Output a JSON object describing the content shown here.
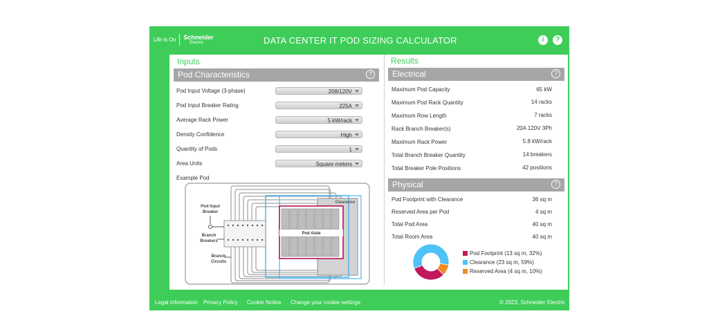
{
  "header": {
    "logo_tagline": "Life Is On",
    "brand_name": "Schneider",
    "brand_sub": "Electric",
    "title": "DATA CENTER IT POD SIZING CALCULATOR",
    "info_icon": "i",
    "help_icon": "?"
  },
  "inputs": {
    "title": "Inputs",
    "section_label": "Pod Characteristics",
    "fields": [
      {
        "label": "Pod Input Voltage (3-phase)",
        "value": "208/120V"
      },
      {
        "label": "Pod Input Breaker Rating",
        "value": "225A"
      },
      {
        "label": "Average Rack Power",
        "value": "5 kW/rack"
      },
      {
        "label": "Density Confidence",
        "value": "High"
      },
      {
        "label": "Quantity of Pods",
        "value": "1"
      },
      {
        "label": "Area Units",
        "value": "Square meters"
      }
    ],
    "example_label": "Example Pod",
    "diagram": {
      "clearance": "Clearance",
      "pod_aisle": "Pod Aisle",
      "pod_input_breaker_1": "Pod Input",
      "pod_input_breaker_2": "Breaker",
      "branch_breakers_1": "Branch",
      "branch_breakers_2": "Breakers",
      "branch_circuits_1": "Branch",
      "branch_circuits_2": "Circuits"
    }
  },
  "results": {
    "title": "Results",
    "electrical": {
      "label": "Electrical",
      "rows": [
        {
          "label": "Maximum Pod Capacity",
          "value": "65 kW"
        },
        {
          "label": "Maximum Pod Rack Quantity",
          "value": "14 racks"
        },
        {
          "label": "Maximum Row Length",
          "value": "7 racks"
        },
        {
          "label": "Rack Branch Breaker(s)",
          "value": "20A 120V 3Ph"
        },
        {
          "label": "Maximum Rack Power",
          "value": "5.8 kW/rack"
        },
        {
          "label": "Total Branch Breaker Quantity",
          "value": "14 breakers"
        },
        {
          "label": "Total Breaker Pole Positions",
          "value": "42 positions"
        }
      ]
    },
    "physical": {
      "label": "Physical",
      "rows": [
        {
          "label": "Pod Footprint with Clearance",
          "value": "36 sq m"
        },
        {
          "label": "Reserved Area per Pod",
          "value": "4 sq m"
        },
        {
          "label": "Total Pod Area",
          "value": "40 sq m"
        },
        {
          "label": "Total Room Area",
          "value": "40 sq m"
        }
      ]
    },
    "chart_data": {
      "type": "pie",
      "categories": [
        "Pod Footprint (13 sq m, 32%)",
        "Clearance (23 sq m, 59%)",
        "Reserved Area (4 sq m, 10%)"
      ],
      "values": [
        32,
        59,
        10
      ],
      "colors": [
        "#c2185b",
        "#4fc3f7",
        "#f08a24"
      ],
      "legend": "right"
    }
  },
  "footer": {
    "links": [
      "Legal Information",
      "Privacy Policy",
      "Cookie Notice",
      "Change your cookie settings"
    ],
    "copyright": "© 2023, Schneider Electric"
  }
}
